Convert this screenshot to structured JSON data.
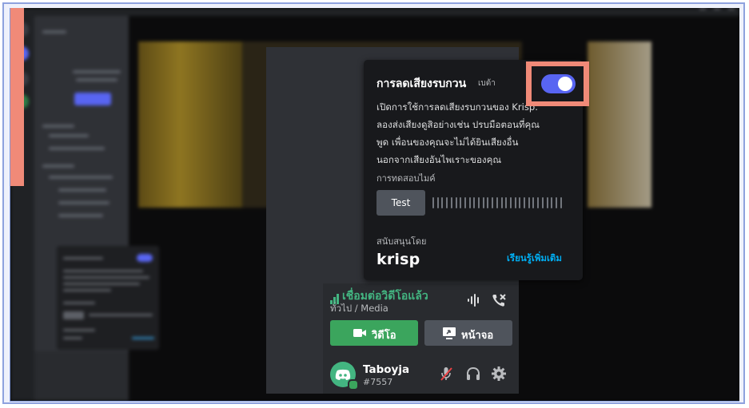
{
  "noise_suppression": {
    "title": "การลดเสียงรบกวน",
    "badge": "เบต้า",
    "toggle_on": true,
    "description_lines": [
      "เปิดการใช้การลดเสียงรบกวนของ Krisp.",
      "ลองส่งเสียงดูสิอย่างเช่น ปรบมือตอนที่คุณ",
      "พูด เพื่อนของคุณจะไม่ได้ยินเสียงอื่น",
      "นอกจากเสียงอันไพเราะของคุณ"
    ],
    "mic_test_label": "การทดสอบไมค์",
    "test_button": "Test",
    "supported_by": "สนับสนุนโดย",
    "brand": "krisp",
    "learn_more": "เรียนรู้เพิ่มเติม"
  },
  "voice": {
    "status": "เชื่อมต่อวิดีโอแล้ว",
    "channel": "ทั่วไป / Media",
    "video_button": "วิดีโอ",
    "screen_button": "หน้าจอ"
  },
  "user": {
    "name": "Taboyja",
    "tag": "#7557"
  },
  "colors": {
    "accent": "#5865f2",
    "connected": "#43b581",
    "highlight": "#f08a78",
    "link": "#00aff4"
  },
  "icons": [
    "wave-icon",
    "hangup-icon",
    "camera-icon",
    "screen-share-icon",
    "discord-logo-icon",
    "mute-icon",
    "headphones-icon",
    "gear-icon"
  ]
}
